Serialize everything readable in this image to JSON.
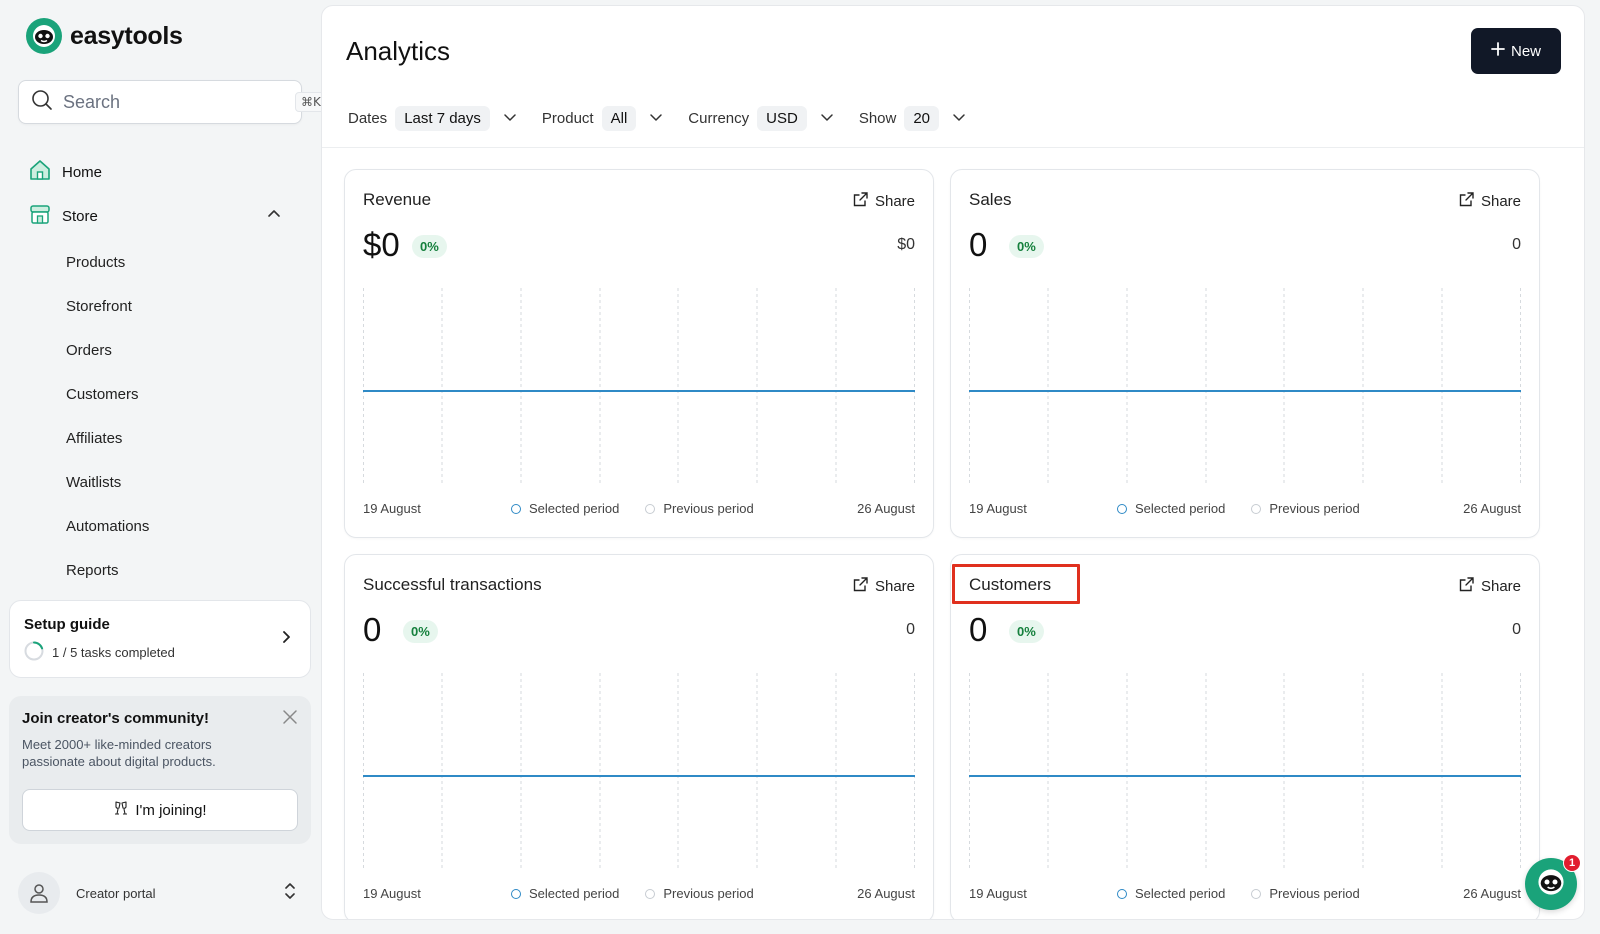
{
  "brand": {
    "name": "easytools"
  },
  "search": {
    "placeholder": "Search",
    "shortcut": "⌘K"
  },
  "sidebar": {
    "home": "Home",
    "store": "Store",
    "store_items": [
      "Products",
      "Storefront",
      "Orders",
      "Customers",
      "Affiliates",
      "Waitlists",
      "Automations",
      "Reports"
    ]
  },
  "setup_guide": {
    "title": "Setup guide",
    "progress": "1 / 5 tasks completed",
    "completed": 1,
    "total": 5
  },
  "community": {
    "title": "Join creator's community!",
    "description": "Meet 2000+ like-minded creators passionate about digital products.",
    "button": "I'm joining!"
  },
  "portal": {
    "label": "Creator portal"
  },
  "main": {
    "title": "Analytics",
    "new_button": "New",
    "filters": [
      {
        "label": "Dates",
        "value": "Last 7 days"
      },
      {
        "label": "Product",
        "value": "All"
      },
      {
        "label": "Currency",
        "value": "USD"
      },
      {
        "label": "Show",
        "value": "20"
      }
    ]
  },
  "share_label": "Share",
  "legend": {
    "selected": "Selected period",
    "previous": "Previous period"
  },
  "cards": [
    {
      "title": "Revenue",
      "value": "$0",
      "change": "0%",
      "previous_value": "$0",
      "start_date": "19 August",
      "end_date": "26 August"
    },
    {
      "title": "Sales",
      "value": "0",
      "change": "0%",
      "previous_value": "0",
      "start_date": "19 August",
      "end_date": "26 August"
    },
    {
      "title": "Successful transactions",
      "value": "0",
      "change": "0%",
      "previous_value": "0",
      "start_date": "19 August",
      "end_date": "26 August"
    },
    {
      "title": "Customers",
      "value": "0",
      "change": "0%",
      "previous_value": "0",
      "start_date": "19 August",
      "end_date": "26 August"
    }
  ],
  "chat": {
    "badge": "1"
  },
  "colors": {
    "accent": "#1aa37a",
    "line": "#2f8ac6",
    "positive": "#15803d",
    "highlight": "#e0301e",
    "dark_button": "#111827"
  }
}
